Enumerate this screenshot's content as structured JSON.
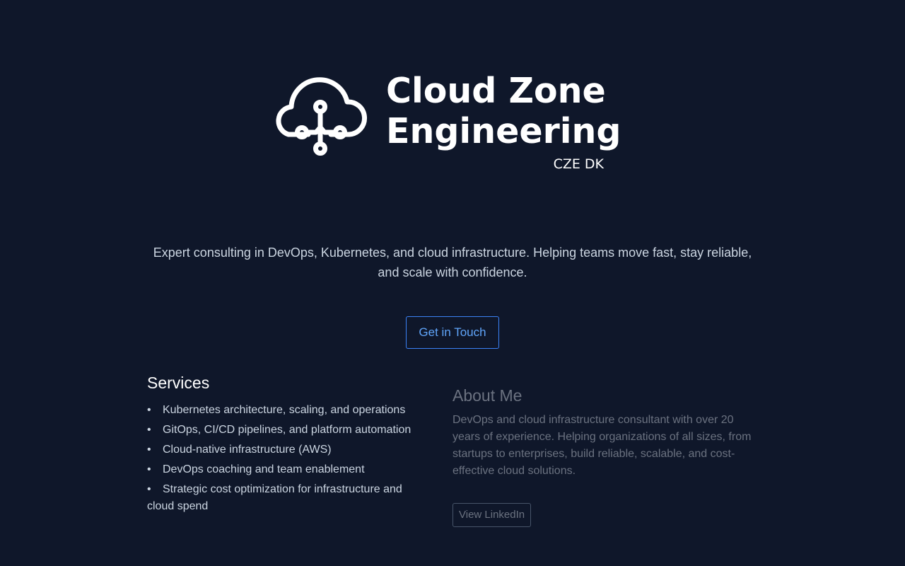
{
  "brand": {
    "title_line1": "Cloud Zone",
    "title_line2": "Engineering",
    "subtitle": "CZE DK",
    "logo_icon": "cloud-network-icon"
  },
  "hero": {
    "tagline": "Expert consulting in DevOps, Kubernetes, and cloud infrastructure. Helping teams move fast, stay reliable, and scale with confidence.",
    "cta_label": "Get in Touch"
  },
  "services": {
    "heading": "Services",
    "bullet": "•",
    "items": [
      "Kubernetes architecture, scaling, and operations",
      "GitOps, CI/CD pipelines, and platform automation",
      "Cloud-native infrastructure (AWS)",
      "DevOps coaching and team enablement",
      "Strategic cost optimization for infrastructure and cloud spend"
    ]
  },
  "about": {
    "heading": "About Me",
    "body": "DevOps and cloud infrastructure consultant with over 20 years of experience. Helping organizations of all sizes, from startups to enterprises, build reliable, scalable, and cost-effective cloud solutions.",
    "linkedin_label": "View LinkedIn"
  },
  "colors": {
    "background": "#0f172a",
    "accent": "#3b82f6",
    "text_primary": "#ffffff",
    "text_secondary": "#cbd5e1",
    "text_muted": "#6b7280"
  }
}
